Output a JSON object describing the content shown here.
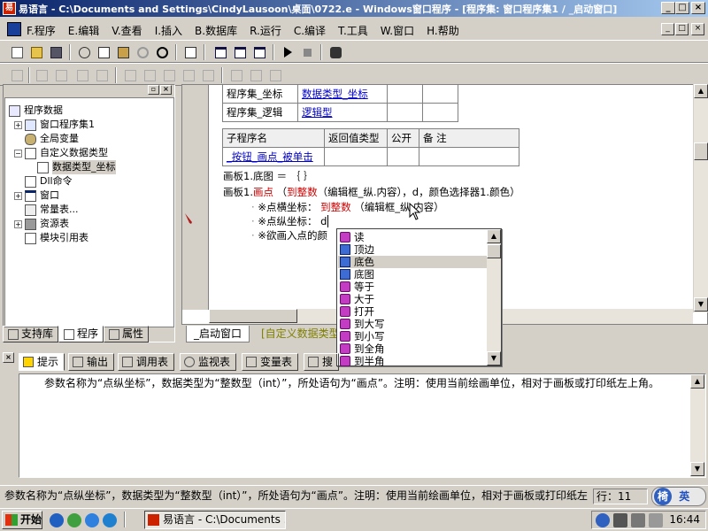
{
  "window": {
    "icon_glyph": "易",
    "title": "易语言 - C:\\Documents and Settings\\CindyLausoon\\桌面\\0722.e - Windows窗口程序 - [程序集: 窗口程序集1 / _启动窗口]",
    "minimize": "_",
    "maximize": "□",
    "close": "×"
  },
  "menubar": {
    "items": [
      "F.程序",
      "E.编辑",
      "V.查看",
      "I.插入",
      "B.数据库",
      "R.运行",
      "C.编译",
      "T.工具",
      "W.窗口",
      "H.帮助"
    ],
    "mdi_minimize": "_",
    "mdi_restore": "□",
    "mdi_close": "×"
  },
  "tree": {
    "header_btn1": "▫",
    "header_btn2": "×",
    "nodes": [
      {
        "label": "程序数据",
        "expander": ""
      },
      {
        "label": "窗口程序集1",
        "expander": "+"
      },
      {
        "label": "全局变量",
        "expander": ""
      },
      {
        "label": "自定义数据类型",
        "expander": "−"
      },
      {
        "label": "数据类型_坐标",
        "expander": ""
      },
      {
        "label": "Dll命令",
        "expander": ""
      },
      {
        "label": "窗口",
        "expander": "+"
      },
      {
        "label": "常量表...",
        "expander": ""
      },
      {
        "label": "资源表",
        "expander": "+"
      },
      {
        "label": "模块引用表",
        "expander": ""
      }
    ]
  },
  "panel_tabs": {
    "support": "支持库",
    "program": "程序",
    "properties": "属性"
  },
  "code": {
    "members": [
      {
        "name": "程序集_坐标",
        "type": "数据类型_坐标"
      },
      {
        "name": "程序集_逻辑",
        "type": "逻辑型"
      }
    ],
    "sub_headers": [
      "子程序名",
      "返回值类型",
      "公开",
      "备 注"
    ],
    "sub_name": "_按钮_画点_被单击",
    "line1": "画板1.底图 ＝ ｛ ｝",
    "line2_obj": "画板1.",
    "line2_method": "画点",
    "line2_args_prefix": "（",
    "line2_func": "到整数",
    "line2_args_rest": "（编辑框_纵.内容），d，颜色选择器1.颜色）",
    "param1_label": "※点横坐标：",
    "param1_func": "到整数",
    "param1_rest": "（编辑框_纵.内容）",
    "param2_label": "※点纵坐标：",
    "param2_value": "d",
    "param3_label": "※欲画入点的颜"
  },
  "editor_tabs": {
    "tab1": "_启动窗口",
    "tab2": "[自定义数据类型"
  },
  "autocomplete": {
    "items": [
      {
        "label": "读",
        "icon": "method-icon"
      },
      {
        "label": "顶边",
        "icon": "property-icon"
      },
      {
        "label": "底色",
        "icon": "property-icon"
      },
      {
        "label": "底图",
        "icon": "property-icon"
      },
      {
        "label": "等于",
        "icon": "method-icon"
      },
      {
        "label": "大于",
        "icon": "method-icon"
      },
      {
        "label": "打开",
        "icon": "method-icon"
      },
      {
        "label": "到大写",
        "icon": "method-icon"
      },
      {
        "label": "到小写",
        "icon": "method-icon"
      },
      {
        "label": "到全角",
        "icon": "method-icon"
      },
      {
        "label": "到半角",
        "icon": "method-icon"
      }
    ],
    "selected_index": 2
  },
  "bottom_tabs": [
    "提示",
    "输出",
    "调用表",
    "监视表",
    "变量表",
    "搜"
  ],
  "hint": {
    "text": "参数名称为“点纵坐标”，数据类型为“整数型（int）”，所处语句为“画点”。注明：使用当前绘画单位，相对于画板或打印纸左上角。"
  },
  "statusbar": {
    "message": "参数名称为“点纵坐标”，数据类型为“整数型（int）”，所处语句为“画点”。注明：使用当前绘画单位，相对于画板或打印纸左",
    "line": "行：11",
    "ime_left": "椅",
    "ime_right": "英"
  },
  "taskbar": {
    "start": "开始",
    "task": "易语言 - C:\\Documents ...",
    "clock": "16:44"
  },
  "colors": {
    "title_start": "#0a246a",
    "title_end": "#a6caf0",
    "face": "#d4d0c8",
    "keyword_blue": "#0000cc",
    "func_red": "#cc0000"
  }
}
